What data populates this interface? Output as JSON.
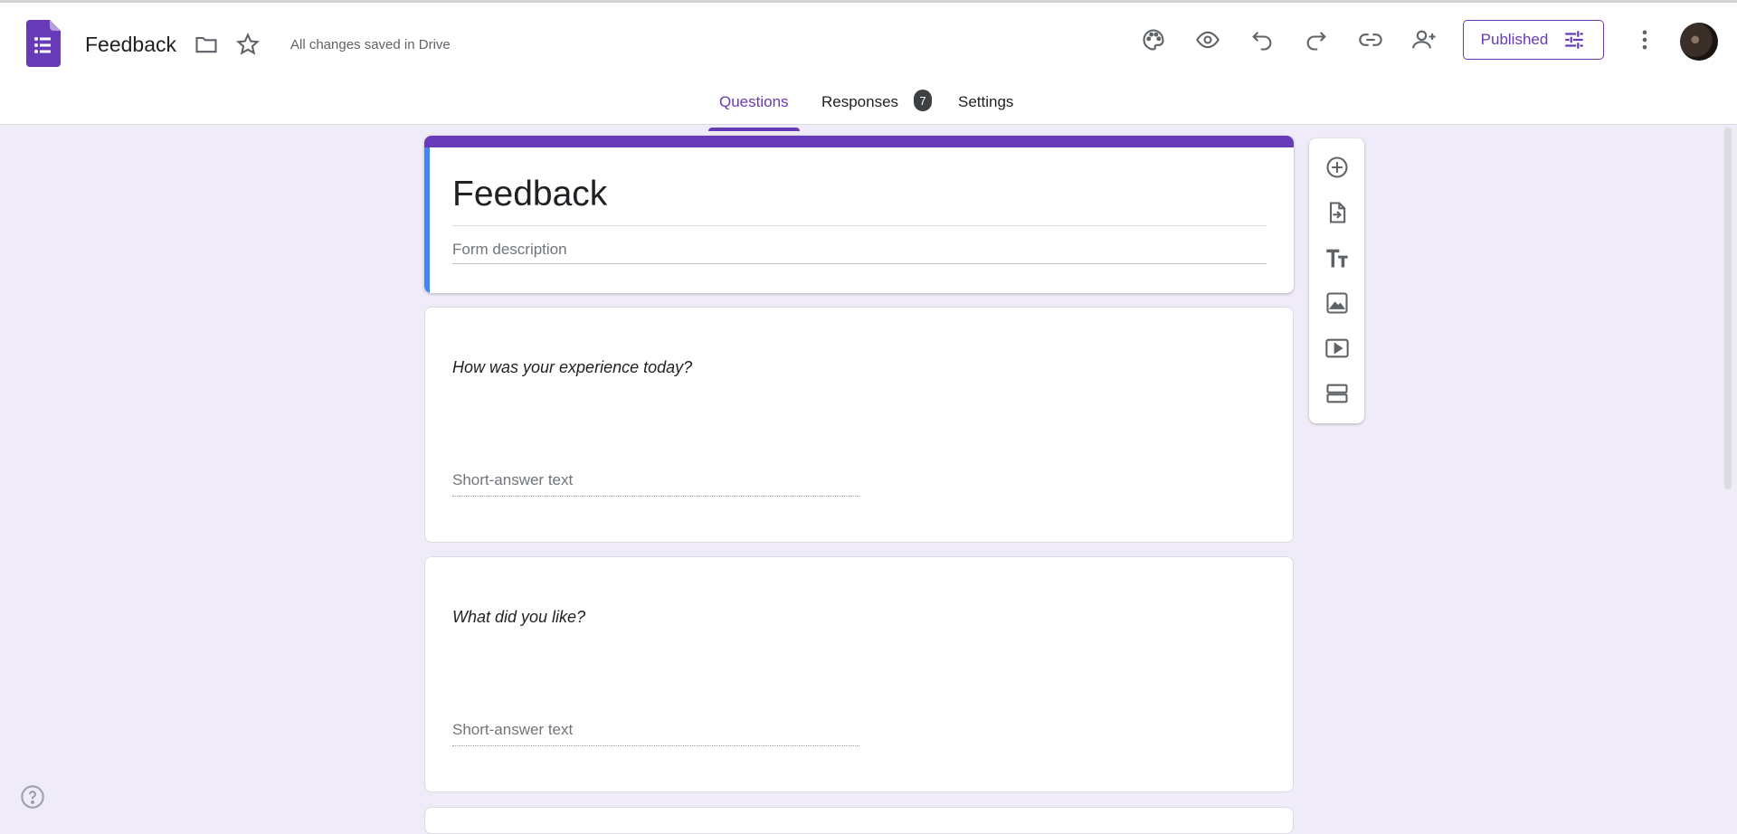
{
  "header": {
    "doc_title": "Feedback",
    "save_status": "All changes saved in Drive",
    "publish_label": "Published",
    "icons": [
      "forms-logo-icon",
      "folder-icon",
      "star-icon",
      "palette-icon",
      "eye-icon",
      "undo-icon",
      "redo-icon",
      "link-icon",
      "add-person-icon",
      "tune-icon",
      "more-vert-icon"
    ]
  },
  "tabs": {
    "questions": "Questions",
    "responses": "Responses",
    "responses_count": "7",
    "settings": "Settings"
  },
  "form": {
    "title": "Feedback",
    "description_placeholder": "Form description"
  },
  "questions": [
    {
      "title": "How was your experience today?",
      "answer_placeholder": "Short-answer text"
    },
    {
      "title": "What did you like?",
      "answer_placeholder": "Short-answer text"
    }
  ],
  "toolbox": [
    "add-question-icon",
    "import-questions-icon",
    "add-title-icon",
    "add-image-icon",
    "add-video-icon",
    "add-section-icon"
  ],
  "colors": {
    "accent": "#673ab7",
    "background": "#f0ebf8",
    "title_sidebar": "#4285f4"
  }
}
